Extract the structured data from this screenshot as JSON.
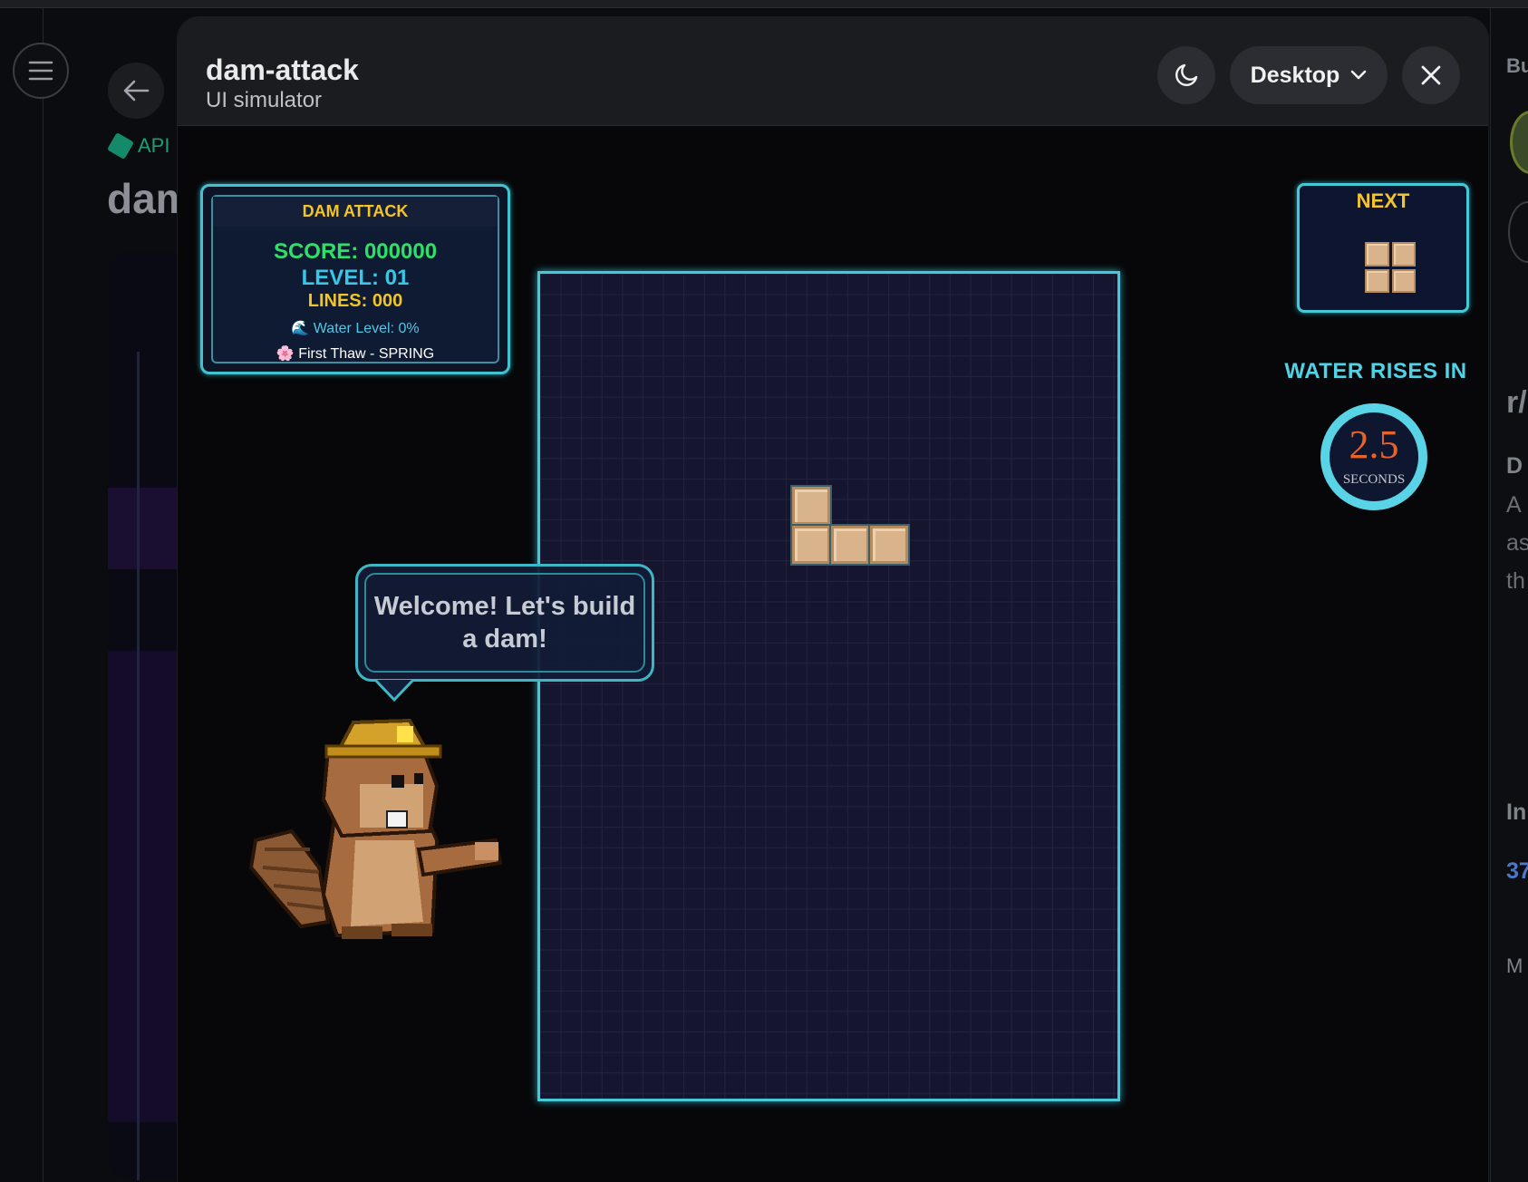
{
  "modal": {
    "title": "dam-attack",
    "subtitle": "UI simulator",
    "device_label": "Desktop"
  },
  "background": {
    "api_label": "API",
    "title": "dam",
    "right_fragments": [
      "Bu",
      "r/",
      "D",
      "A",
      "as",
      "th",
      "In",
      "37",
      "M"
    ]
  },
  "game": {
    "stats": {
      "title": "DAM ATTACK",
      "score": "SCORE: 000000",
      "level": "LEVEL: 01",
      "lines": "LINES: 000",
      "water": "🌊 Water Level: 0%",
      "season": "🌸 First Thaw - SPRING"
    },
    "speech": "Welcome! Let's build a dam!",
    "next_label": "NEXT",
    "water_rises_label": "WATER RISES IN",
    "timer_value": "2.5",
    "timer_unit": "SECONDS",
    "current_piece": "J",
    "next_piece": "O"
  },
  "colors": {
    "accent_cyan": "#45c9d6",
    "score_green": "#2ee06a",
    "label_yellow": "#f2c52e",
    "block_tan": "#d8b38c",
    "timer_orange": "#e8632b"
  }
}
